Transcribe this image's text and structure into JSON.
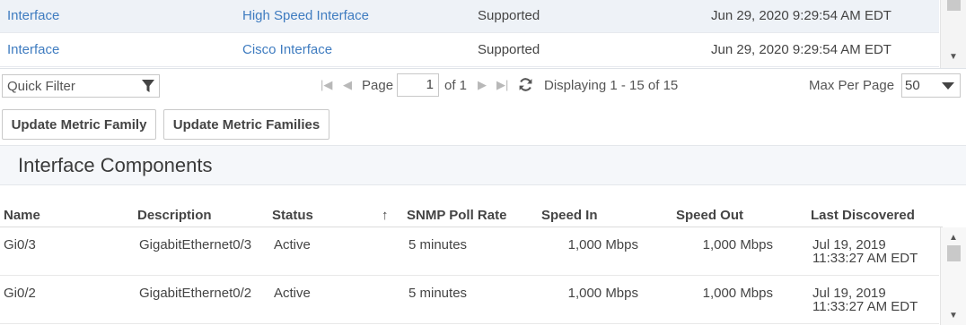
{
  "metric_table": {
    "rows": [
      {
        "family": "Interface",
        "description": "High Speed Interface",
        "status": "Supported",
        "timestamp": "Jun 29, 2020 9:29:54 AM EDT"
      },
      {
        "family": "Interface",
        "description": "Cisco Interface",
        "status": "Supported",
        "timestamp": "Jun 29, 2020 9:29:54 AM EDT"
      }
    ]
  },
  "toolbar": {
    "quick_filter_placeholder": "Quick Filter",
    "page_label": "Page",
    "page_value": "1",
    "of_label": "of 1",
    "displaying": "Displaying 1 - 15 of 15",
    "max_per_page_label": "Max Per Page",
    "max_per_page_value": "50",
    "icons": [
      "filter-icon",
      "first-page-icon",
      "prev-page-icon",
      "next-page-icon",
      "last-page-icon",
      "refresh-icon",
      "chevron-down-icon"
    ]
  },
  "buttons": {
    "update_one": "Update Metric Family",
    "update_all": "Update Metric Families"
  },
  "section": {
    "title": "Interface Components"
  },
  "components": {
    "columns": [
      "Name",
      "Description",
      "Status",
      "↑",
      "SNMP Poll Rate",
      "Speed In",
      "Speed Out",
      "Last Discovered"
    ],
    "rows": [
      {
        "name": "Gi0/3",
        "description": "GigabitEthernet0/3",
        "status": "Active",
        "poll_rate": "5 minutes",
        "speed_in": "1,000 Mbps",
        "speed_out": "1,000 Mbps",
        "last_discovered_date": "Jul 19, 2019",
        "last_discovered_time": "11:33:27 AM EDT"
      },
      {
        "name": "Gi0/2",
        "description": "GigabitEthernet0/2",
        "status": "Active",
        "poll_rate": "5 minutes",
        "speed_in": "1,000 Mbps",
        "speed_out": "1,000 Mbps",
        "last_discovered_date": "Jul 19, 2019",
        "last_discovered_time": "11:33:27 AM EDT"
      }
    ]
  },
  "colors": {
    "link": "#3f7cc0",
    "selected_row": "#eef2f7",
    "section_bg": "#f5f7fa"
  }
}
